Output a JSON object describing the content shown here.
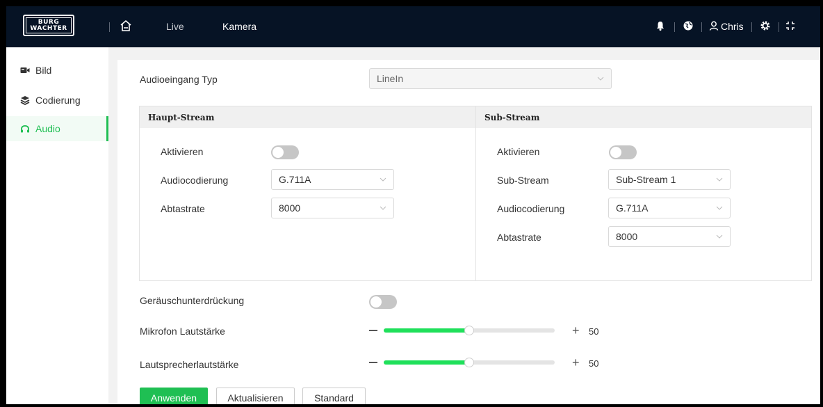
{
  "brand": {
    "line1": "BURG",
    "line2": "WACHTER"
  },
  "topnav": {
    "live": "Live",
    "kamera": "Kamera"
  },
  "user": {
    "name": "Chris"
  },
  "sidebar": {
    "items": [
      {
        "label": "Bild",
        "icon": "camera-icon"
      },
      {
        "label": "Codierung",
        "icon": "layers-icon"
      },
      {
        "label": "Audio",
        "icon": "headphones-icon",
        "active": true
      }
    ]
  },
  "audio_input": {
    "label": "Audioeingang  Typ",
    "value": "LineIn"
  },
  "main_stream": {
    "title": "Haupt-Stream",
    "enable_label": "Aktivieren",
    "enabled": false,
    "codec_label": "Audiocodierung",
    "codec_value": "G.711A",
    "rate_label": "Abtastrate",
    "rate_value": "8000"
  },
  "sub_stream": {
    "title": "Sub-Stream",
    "enable_label": "Aktivieren",
    "enabled": false,
    "stream_label": "Sub-Stream",
    "stream_value": "Sub-Stream 1",
    "codec_label": "Audiocodierung",
    "codec_value": "G.711A",
    "rate_label": "Abtastrate",
    "rate_value": "8000"
  },
  "noise": {
    "label": "Geräuschunterdrückung",
    "enabled": false
  },
  "mic_volume": {
    "label": "Mikrofon Lautstärke",
    "value": "50"
  },
  "speaker_volume": {
    "label": "Lautsprecherlautstärke",
    "value": "50"
  },
  "buttons": {
    "apply": "Anwenden",
    "refresh": "Aktualisieren",
    "default": "Standard"
  },
  "colors": {
    "accent": "#1fbf53",
    "topbar": "#061325",
    "slider": "#1fe05a"
  }
}
